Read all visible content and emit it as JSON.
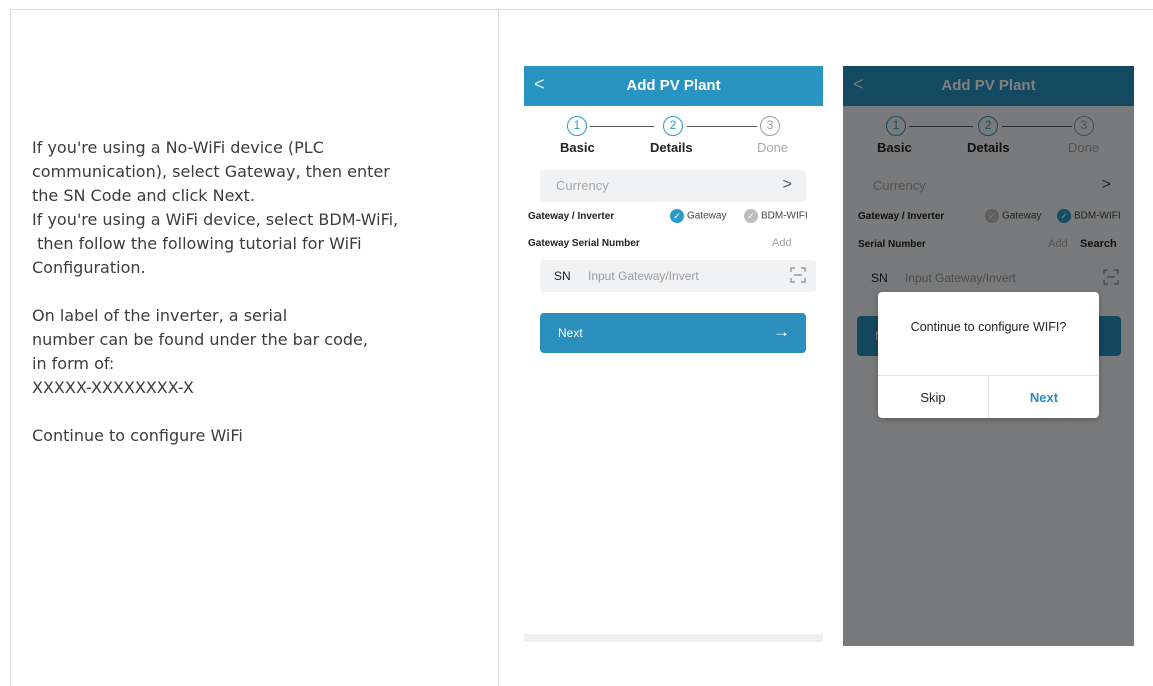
{
  "description": {
    "lines": [
      "If you're using a No-WiFi device (PLC",
      "communication), select Gateway, then enter",
      "the SN Code and click Next.",
      "If you're using a WiFi device, select BDM-WiFi,",
      " then follow the following tutorial for WiFi",
      "Configuration.",
      "On label of the inverter, a serial",
      "number can be found under the bar code,",
      "in form of:",
      "XXXXX-XXXXXXXX-X",
      "Continue to configure WiFi"
    ]
  },
  "phone1": {
    "back": "<",
    "title": "Add PV Plant",
    "steps": [
      {
        "num": "1",
        "label": "Basic"
      },
      {
        "num": "2",
        "label": "Details"
      },
      {
        "num": "3",
        "label": "Done"
      }
    ],
    "currency_label": "Currency",
    "currency_chevron": ">",
    "gateway_row_label": "Gateway / Inverter",
    "option_gateway": "Gateway",
    "option_bdm": "BDM-WIFI",
    "serial_row_label": "Gateway Serial Number",
    "add_label": "Add",
    "sn_prefix": "SN",
    "sn_placeholder": "Input Gateway/Invert",
    "next_label": "Next",
    "next_arrow": "→"
  },
  "phone2": {
    "back": "<",
    "title": "Add PV Plant",
    "steps": [
      {
        "num": "1",
        "label": "Basic"
      },
      {
        "num": "2",
        "label": "Details"
      },
      {
        "num": "3",
        "label": "Done"
      }
    ],
    "currency_label": "Currency",
    "currency_chevron": ">",
    "gateway_row_label": "Gateway / Inverter",
    "option_gateway": "Gateway",
    "option_bdm": "BDM-WIFI",
    "serial_row_label": "Serial Number",
    "add_label": "Add",
    "search_label": "Search",
    "sn_prefix": "SN",
    "sn_placeholder": "Input Gateway/Invert",
    "next_label": "N",
    "dialog": {
      "message": "Continue to configure WIFI?",
      "skip": "Skip",
      "next": "Next"
    }
  },
  "colors": {
    "accent": "#2a9bc9",
    "titlebar": "#2794c2",
    "button": "#2a8fbd"
  },
  "icons": {
    "back": "chevron-left-icon",
    "currency": "chevron-right-icon",
    "check": "check-circle-icon",
    "scan": "scan-icon",
    "arrow": "arrow-right-icon"
  }
}
